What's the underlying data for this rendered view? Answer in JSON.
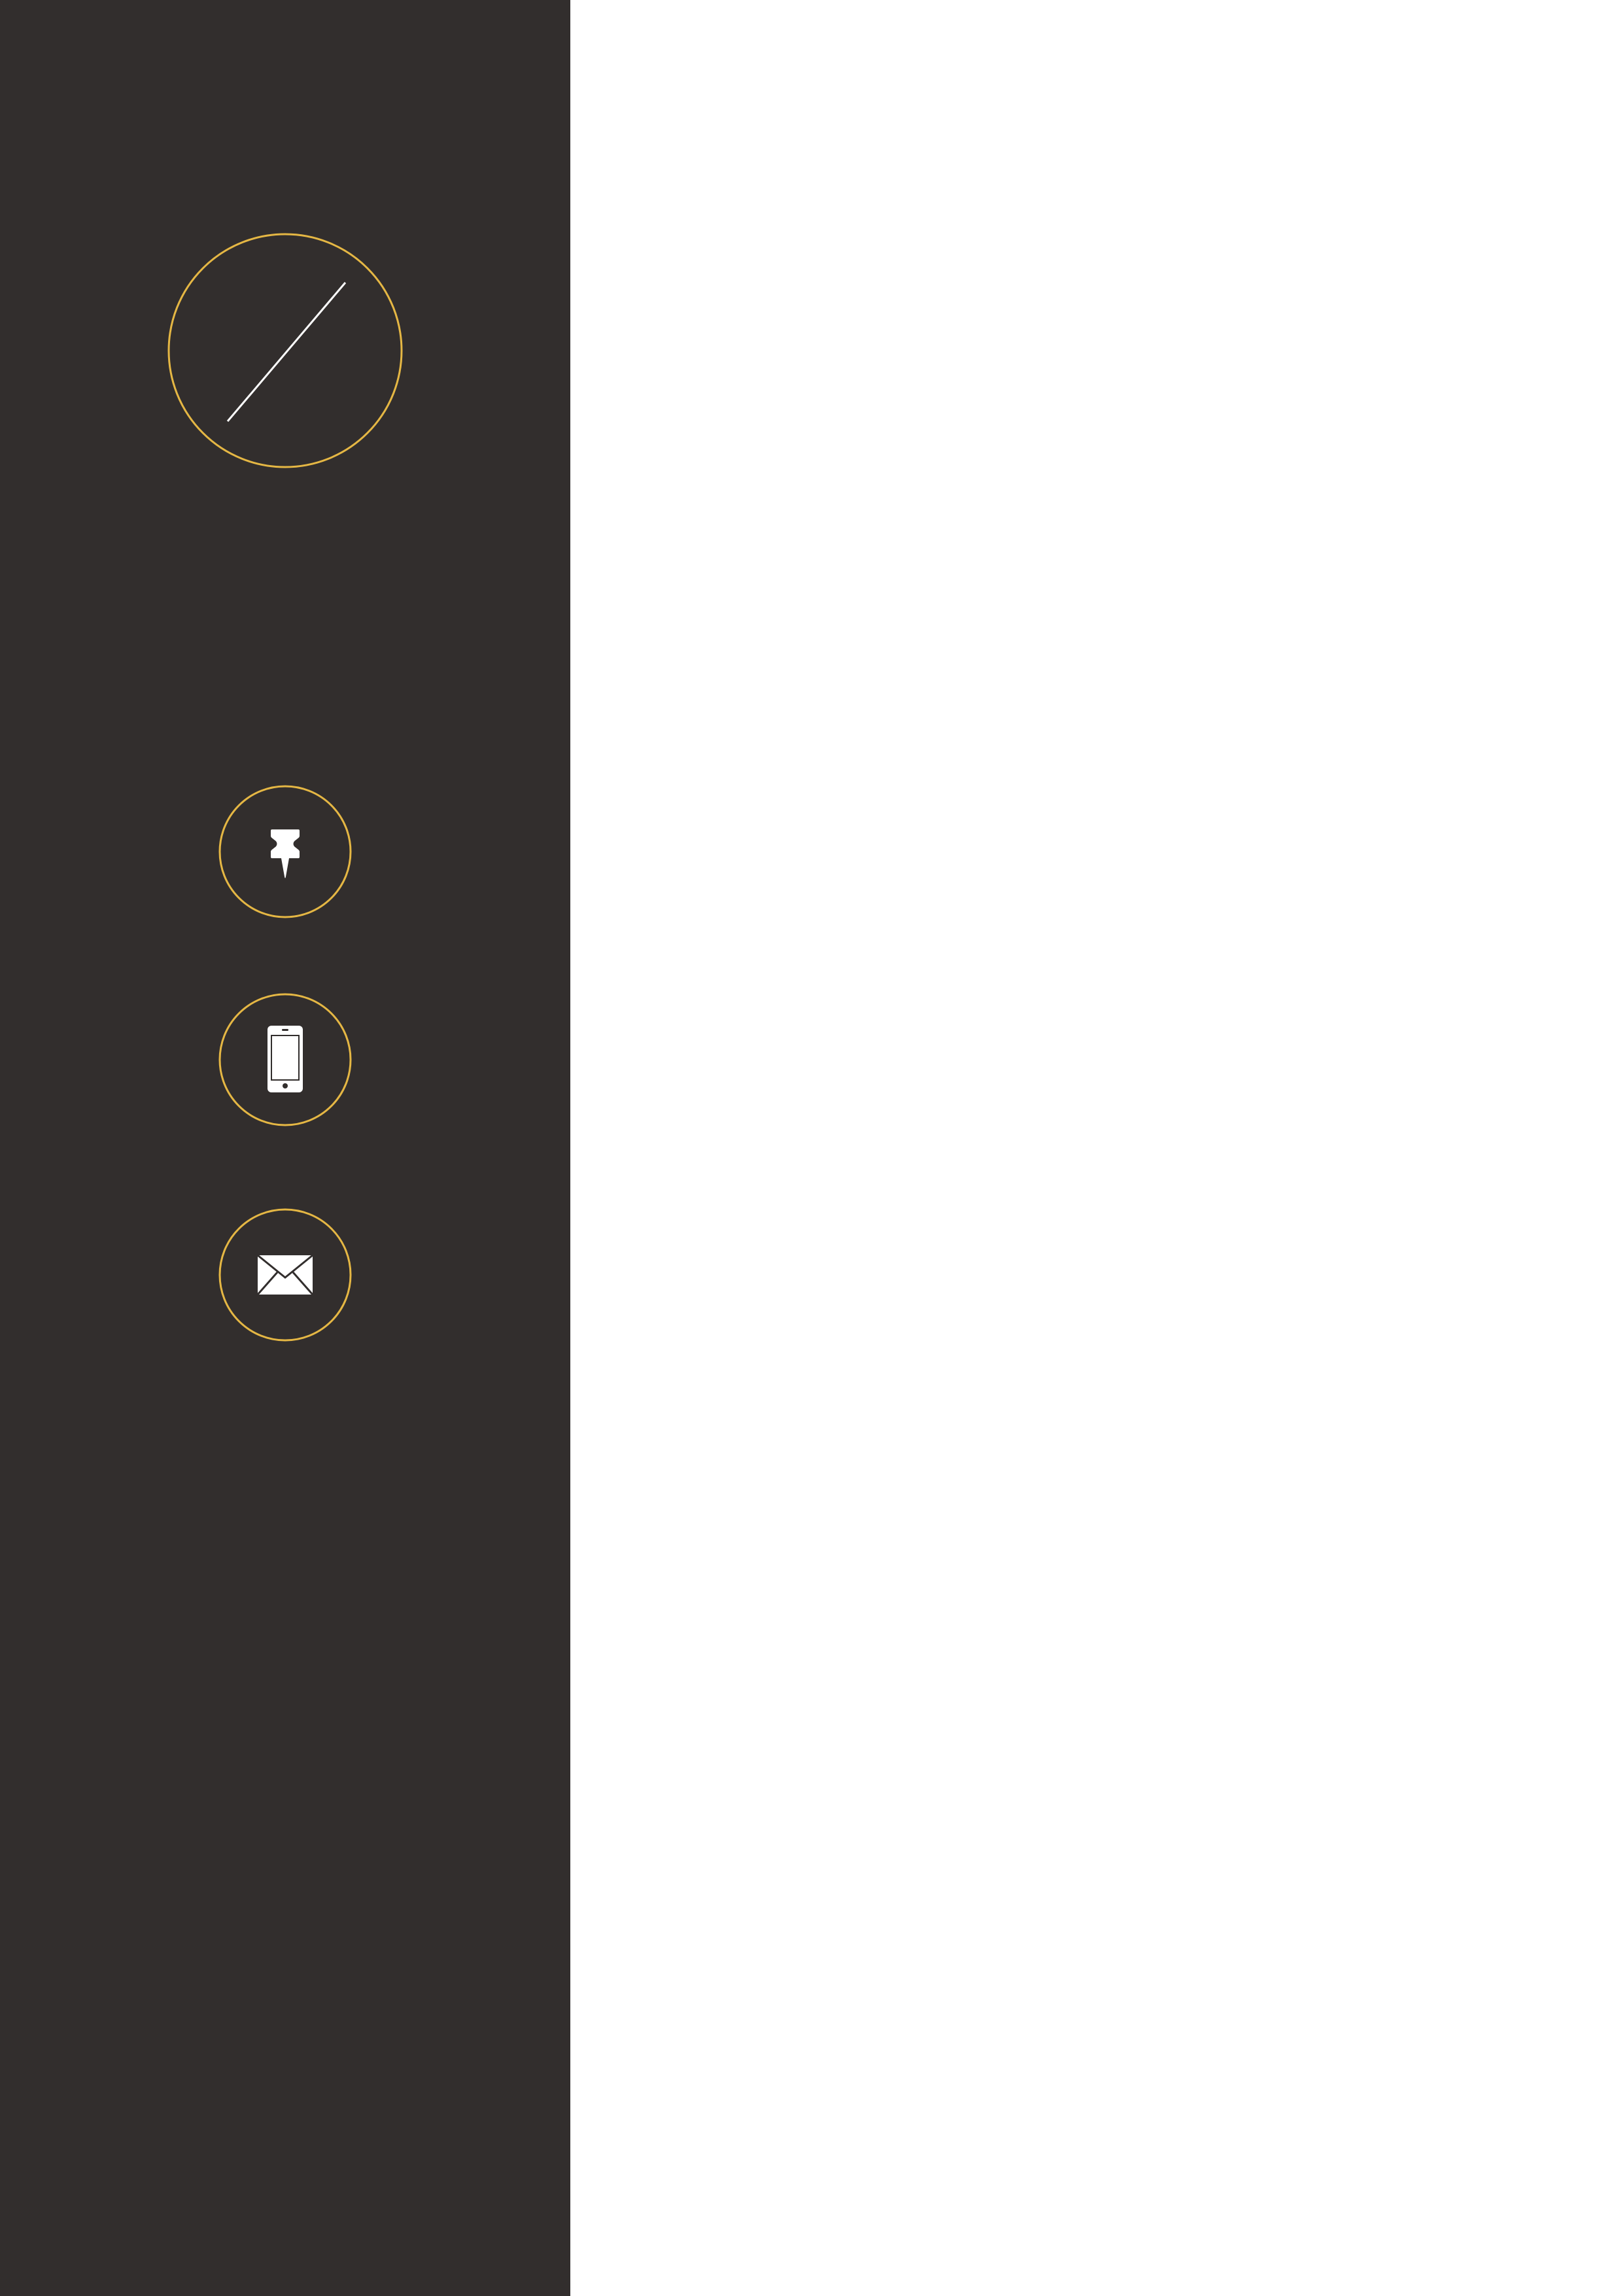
{
  "colors": {
    "sidebar_background": "#322e2d",
    "accent": "#e5b744",
    "icon_fill": "#ffffff",
    "page_background": "#ffffff"
  },
  "sidebar": {
    "avatar": {
      "icon": "empty-photo-placeholder-icon"
    },
    "contact_icons": [
      {
        "icon": "pushpin-icon"
      },
      {
        "icon": "smartphone-icon"
      },
      {
        "icon": "envelope-icon"
      }
    ]
  }
}
